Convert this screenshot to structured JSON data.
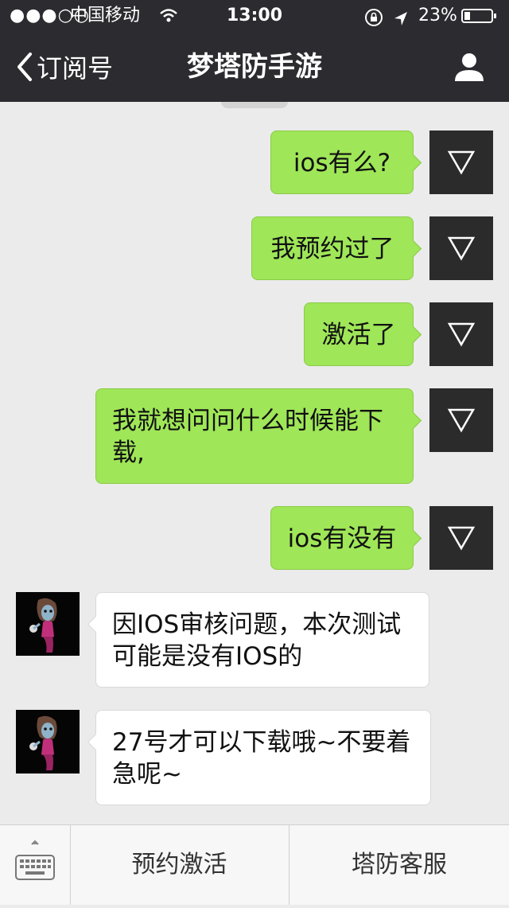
{
  "status_bar": {
    "signal": "●●●○○",
    "carrier": "中国移动",
    "time": "13:00",
    "battery_percent": "23%",
    "battery_level": 0.23,
    "icons": [
      "wifi-icon",
      "orientation-lock-icon",
      "location-icon",
      "battery-icon"
    ]
  },
  "nav": {
    "back_label": "订阅号",
    "title": "梦塔防手游",
    "icons": [
      "chevron-left-icon",
      "profile-icon"
    ]
  },
  "messages": [
    {
      "from": "me",
      "text": "ios有么?"
    },
    {
      "from": "me",
      "text": "我预约过了"
    },
    {
      "from": "me",
      "text": "激活了"
    },
    {
      "from": "me",
      "text": "我就想问问什么时候能下载,"
    },
    {
      "from": "me",
      "text": "ios有没有"
    },
    {
      "from": "them",
      "text": "因IOS审核问题，本次测试可能是没有IOS的"
    },
    {
      "from": "them",
      "text": "27号才可以下载哦~不要着急呢~"
    }
  ],
  "bottom_menu": {
    "keyboard_toggle_icon": "keyboard-icon",
    "buttons": [
      "预约激活",
      "塔防客服"
    ]
  },
  "colors": {
    "nav_bg": "#2b2b30",
    "chat_bg": "#ebebeb",
    "my_bubble": "#9fe658",
    "their_bubble": "#ffffff"
  }
}
